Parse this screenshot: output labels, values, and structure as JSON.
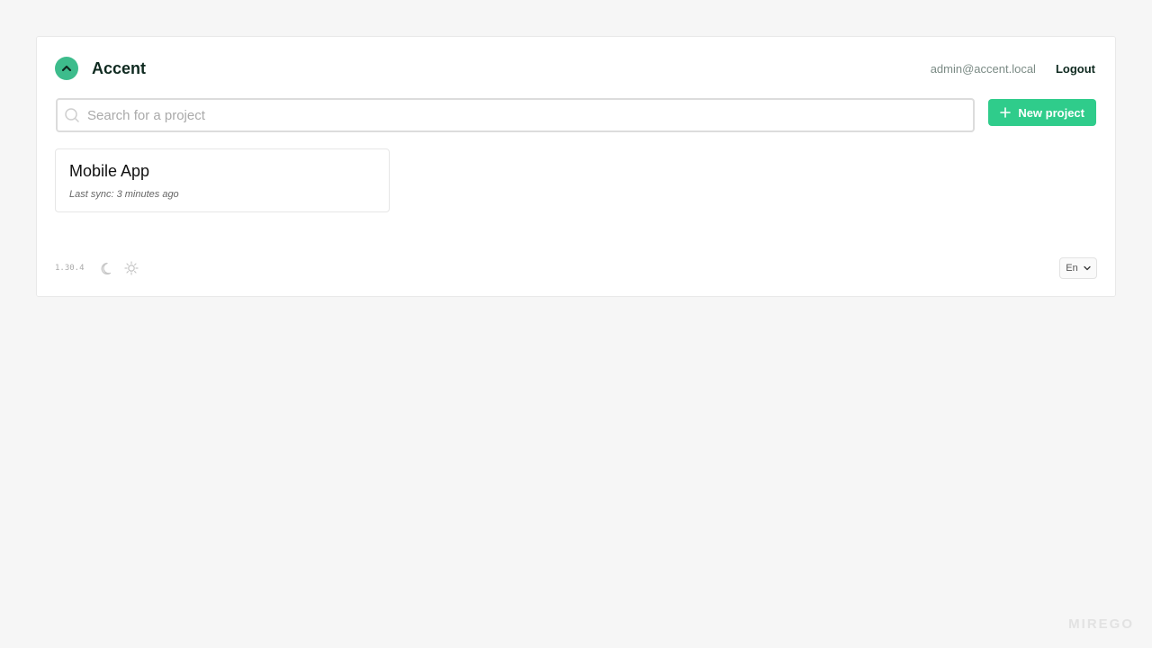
{
  "header": {
    "app_title": "Accent",
    "user_email": "admin@accent.local",
    "logout_label": "Logout"
  },
  "search": {
    "placeholder": "Search for a project",
    "value": ""
  },
  "toolbar": {
    "new_project_label": "New project"
  },
  "projects": [
    {
      "name": "Mobile App",
      "last_sync": "Last sync: 3 minutes ago"
    }
  ],
  "footer": {
    "version": "1.30.4",
    "language": "En",
    "watermark": "MIREGO"
  },
  "colors": {
    "accent": "#2fcc8b",
    "logo": "#3dbc8c",
    "title": "#0f2a20"
  },
  "icons": [
    "chevron-up-icon",
    "search-icon",
    "plus-icon",
    "moon-icon",
    "sun-icon",
    "chevron-down-icon"
  ]
}
